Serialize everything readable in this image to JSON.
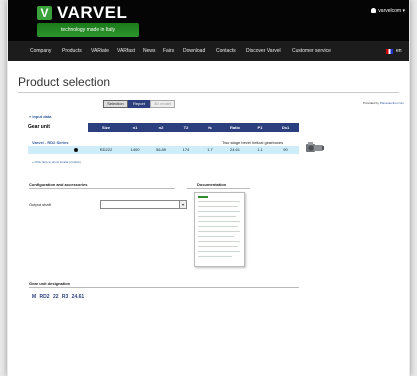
{
  "header": {
    "brand": "VARVEL",
    "tagline": "technology made in Italy",
    "user": "varvelcom"
  },
  "nav": {
    "items": [
      {
        "label": "Company"
      },
      {
        "label": "Products"
      },
      {
        "label": "VARiate"
      },
      {
        "label": "VARfast"
      },
      {
        "label": "News"
      },
      {
        "label": "Fairs"
      },
      {
        "label": "Download"
      },
      {
        "label": "Contacts"
      },
      {
        "label": "Discover Varvel"
      },
      {
        "label": "Customer service"
      }
    ],
    "language": "en"
  },
  "page": {
    "title": "Product selection",
    "steps": [
      {
        "label": "Selection",
        "state": "normal"
      },
      {
        "label": "Report",
        "state": "active"
      },
      {
        "label": "3D model",
        "state": "disabled"
      }
    ],
    "powered_by": {
      "prefix": "Provided by",
      "name": "Planselection.com"
    }
  },
  "input_data": {
    "label": "Input data"
  },
  "gear_unit": {
    "label": "Gear unit",
    "columns": [
      "Size",
      "n1",
      "n2",
      "T2",
      "fs",
      "Ratio",
      "P1",
      "Ds1"
    ],
    "series": "Varvel - RD2 Series",
    "description": "Two stage bevel helical gearboxes",
    "row": [
      "RD222",
      "1400",
      "56.89",
      "174",
      "1.7",
      "24.61",
      "1.1",
      "90"
    ],
    "similar_link": "Click here to show similar products"
  },
  "configuration": {
    "title": "Configuration and accessories",
    "output_shaft_label": "Output shaft",
    "output_shaft_value": ""
  },
  "documentation": {
    "title": "Documentation"
  },
  "designation": {
    "title": "Gear unit designation",
    "code": "M RD2 22 R3 24.61"
  },
  "colors": {
    "brand_green": "#2e962e",
    "accent_blue": "#2b3f7e",
    "highlight_row": "#cdeef9",
    "link_blue": "#2f5c9e"
  }
}
